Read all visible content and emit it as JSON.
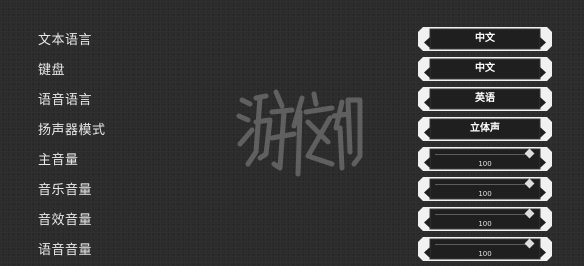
{
  "watermark": "游侠网",
  "settings": [
    {
      "label": "文本语言",
      "kind": "select",
      "value": "中文"
    },
    {
      "label": "键盘",
      "kind": "select",
      "value": "中文"
    },
    {
      "label": "语音语言",
      "kind": "select",
      "value": "英语"
    },
    {
      "label": "扬声器模式",
      "kind": "select",
      "value": "立体声"
    },
    {
      "label": "主音量",
      "kind": "slider",
      "value": "100"
    },
    {
      "label": "音乐音量",
      "kind": "slider",
      "value": "100"
    },
    {
      "label": "音效音量",
      "kind": "slider",
      "value": "100"
    },
    {
      "label": "语音音量",
      "kind": "slider",
      "value": "100"
    }
  ]
}
